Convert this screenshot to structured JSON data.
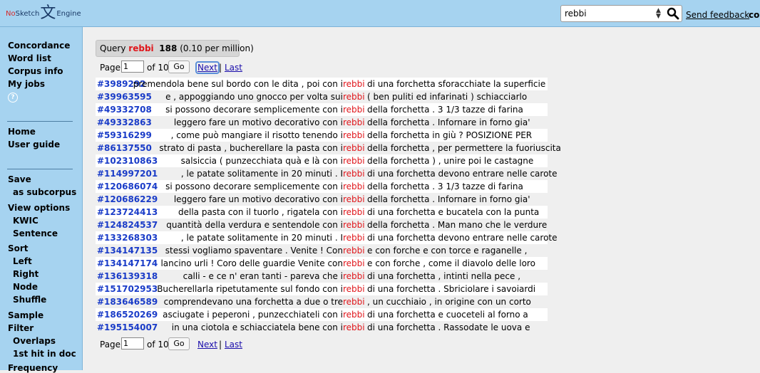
{
  "header": {
    "logo_no": "No",
    "logo_sketch": "Sketch",
    "logo_glyph": "文",
    "logo_engine": "Engine",
    "search_value": "rebbi",
    "feedback_label": "Send feedback",
    "corpus_label": "cor"
  },
  "sidebar": {
    "concordance": "Concordance",
    "word_list": "Word list",
    "corpus_info": "Corpus info",
    "my_jobs": "My jobs",
    "help": "?",
    "home": "Home",
    "user_guide": "User guide",
    "save": "Save",
    "as_subcorpus": "as subcorpus",
    "view_options": "View options",
    "kwic": "KWIC",
    "sentence": "Sentence",
    "sort": "Sort",
    "left": "Left",
    "right": "Right",
    "node": "Node",
    "shuffle": "Shuffle",
    "sample": "Sample",
    "filter": "Filter",
    "overlaps": "Overlaps",
    "first_hit": "1st hit in doc",
    "frequency": "Frequency"
  },
  "summary": {
    "query_label": "Query",
    "query_word": "rebbi",
    "hits": "188",
    "per_million": "(0.10 per million)"
  },
  "pager": {
    "page_label": "Page",
    "page_value": "1",
    "of_label": "of 10",
    "go_label": "Go",
    "next_label": "Next",
    "separator": "|",
    "last_label": "Last"
  },
  "rows": [
    {
      "ref": "#3989292",
      "left": "premendola bene sul bordo con le dita , poi con i",
      "kw": "rebbi",
      "right": "di una forchetta sforacchiate la superficie"
    },
    {
      "ref": "#39963595",
      "left": "e , appoggiando uno gnocco per volta sui",
      "kw": "rebbi",
      "right": "( ben puliti ed infarinati ) schiacciarlo"
    },
    {
      "ref": "#49332708",
      "left": "si possono decorare semplicemente con i",
      "kw": "rebbi",
      "right": "della forchetta . 3 1/3 tazze di farina"
    },
    {
      "ref": "#49332863",
      "left": "leggero fare un motivo decorativo con i",
      "kw": "rebbi",
      "right": "della forchetta . Infornare in forno gia'"
    },
    {
      "ref": "#59316299",
      "left": ", come può mangiare il risotto tenendo i",
      "kw": "rebbi",
      "right": "della forchetta in giù ? POSIZIONE PER"
    },
    {
      "ref": "#86137550",
      "left": "strato di pasta , bucherellare la pasta con i",
      "kw": "rebbi",
      "right": "della forchetta , per permettere la fuoriuscita"
    },
    {
      "ref": "#102310863",
      "left": "salsiccia ( punzecchiata quà e là con i",
      "kw": "rebbi",
      "right": "della forchetta ) , unire poi le castagne"
    },
    {
      "ref": "#114997201",
      "left": ", le patate solitamente in 20 minuti . I",
      "kw": "rebbi",
      "right": "di una forchetta devono entrare nelle carote"
    },
    {
      "ref": "#120686074",
      "left": "si possono decorare semplicemente con i",
      "kw": "rebbi",
      "right": "della forchetta . 3 1/3 tazze di farina"
    },
    {
      "ref": "#120686229",
      "left": "leggero fare un motivo decorativo con i",
      "kw": "rebbi",
      "right": "della forchetta . Infornare in forno gia'"
    },
    {
      "ref": "#123724413",
      "left": "della pasta con il tuorlo , rigatela con i",
      "kw": "rebbi",
      "right": "di una forchetta e bucatela con la punta"
    },
    {
      "ref": "#124824537",
      "left": "quantità della verdura e sentendole con i",
      "kw": "rebbi",
      "right": "della forchetta . Man mano che le verdure"
    },
    {
      "ref": "#133268303",
      "left": ", le patate solitamente in 20 minuti . I",
      "kw": "rebbi",
      "right": "di una forchetta devono entrare nelle carote"
    },
    {
      "ref": "#134147135",
      "left": "stessi vogliamo spaventare . Venite ! Con",
      "kw": "rebbi",
      "right": "e con forche e con torce e raganelle ,"
    },
    {
      "ref": "#134147174",
      "left": "lancino urli ! Coro delle guardie Venite con",
      "kw": "rebbi",
      "right": "e con forche , come il diavolo delle loro"
    },
    {
      "ref": "#136139318",
      "left": "calli - e ce n' eran tanti - pareva che i",
      "kw": "rebbi",
      "right": "di una forchetta , intinti nella pece ,"
    },
    {
      "ref": "#151702953",
      "left": "Bucherellarla ripetutamente sul fondo con i",
      "kw": "rebbi",
      "right": "di una forchetta . Sbriciolare i savoiardi"
    },
    {
      "ref": "#183646589",
      "left": "comprendevano una forchetta a due o tre",
      "kw": "rebbi",
      "right": ", un cucchiaio , in origine con un corto"
    },
    {
      "ref": "#186520269",
      "left": "asciugate i peperoni , punzecchiateli con i",
      "kw": "rebbi",
      "right": "di una forchetta e cuoceteli al forno a"
    },
    {
      "ref": "#195154007",
      "left": "in una ciotola e schiacciatela bene con i",
      "kw": "rebbi",
      "right": "di una forchetta . Rassodate le uova e"
    }
  ]
}
